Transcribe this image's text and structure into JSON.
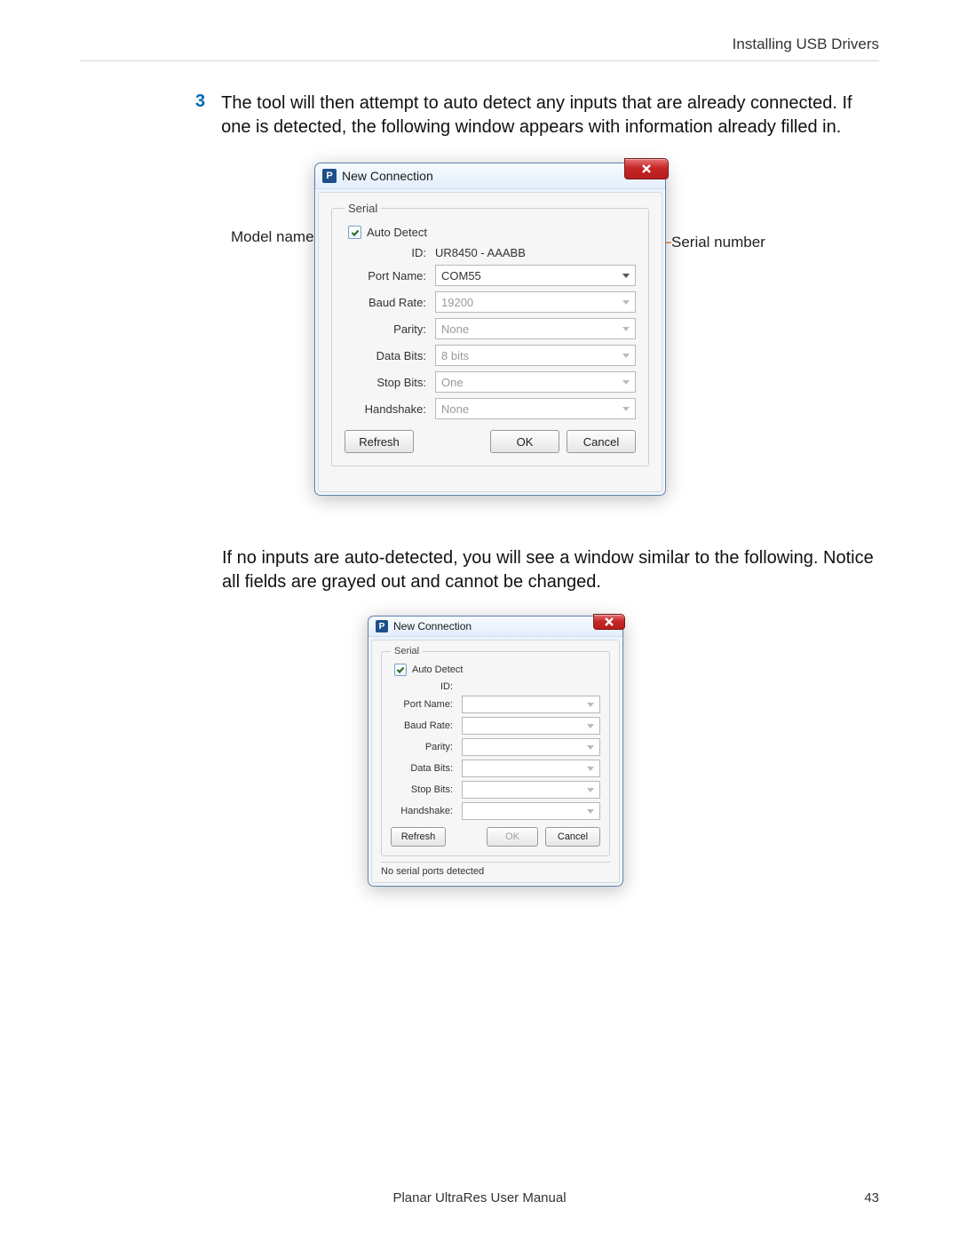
{
  "header": {
    "title": "Installing USB Drivers"
  },
  "step": {
    "number": "3",
    "text": "The tool will then attempt to auto detect any inputs that are already connected. If one is detected, the following window appears with information already filled in."
  },
  "callouts": {
    "model_name": "Model name",
    "serial_number": "Serial number"
  },
  "fig1": {
    "title": "New Connection",
    "app_icon_letter": "P",
    "legend": "Serial",
    "auto_detect": "Auto Detect",
    "labels": {
      "id": "ID:",
      "port": "Port Name:",
      "baud": "Baud Rate:",
      "parity": "Parity:",
      "databits": "Data Bits:",
      "stopbits": "Stop Bits:",
      "handshake": "Handshake:"
    },
    "values": {
      "id": "UR8450 - AAABB",
      "port": "COM55",
      "baud": "19200",
      "parity": "None",
      "databits": "8 bits",
      "stopbits": "One",
      "handshake": "None"
    },
    "buttons": {
      "refresh": "Refresh",
      "ok": "OK",
      "cancel": "Cancel"
    }
  },
  "para2": "If no inputs are auto-detected, you will see a window similar to the following. Notice all fields are grayed out and cannot be changed.",
  "fig2": {
    "title": "New Connection",
    "app_icon_letter": "P",
    "legend": "Serial",
    "auto_detect": "Auto Detect",
    "labels": {
      "id": "ID:",
      "port": "Port Name:",
      "baud": "Baud Rate:",
      "parity": "Parity:",
      "databits": "Data Bits:",
      "stopbits": "Stop Bits:",
      "handshake": "Handshake:"
    },
    "buttons": {
      "refresh": "Refresh",
      "ok": "OK",
      "cancel": "Cancel"
    },
    "status": "No serial ports detected"
  },
  "footer": {
    "doc_title": "Planar UltraRes User Manual",
    "page": "43"
  }
}
